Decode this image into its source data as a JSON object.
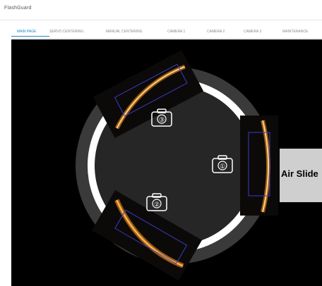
{
  "app": {
    "title": "FlashGuard"
  },
  "tabs": [
    {
      "label": "MAIN PAGE",
      "active": true
    },
    {
      "label": "SERVO CENTERING",
      "active": false
    },
    {
      "label": "MANUAL CENTERING",
      "active": false
    },
    {
      "label": "CAMERA 1",
      "active": false
    },
    {
      "label": "CAMERA 2",
      "active": false
    },
    {
      "label": "CAMERA 3",
      "active": false
    },
    {
      "label": "MAINTENANCE",
      "active": false
    }
  ],
  "main": {
    "air_slide_label": "Air Slide",
    "cameras": [
      {
        "number": "①",
        "icon": "camera-icon"
      },
      {
        "number": "②",
        "icon": "camera-icon"
      },
      {
        "number": "③",
        "icon": "camera-icon"
      }
    ]
  },
  "colors": {
    "active_tab": "#1e88c9",
    "background": "#000000",
    "outer_ring": "#3a3a3a",
    "inner_ring": "#ffffff",
    "disc": "#262626",
    "flash_glow": "#ffb347",
    "roi_box": "#3a3ac8"
  }
}
